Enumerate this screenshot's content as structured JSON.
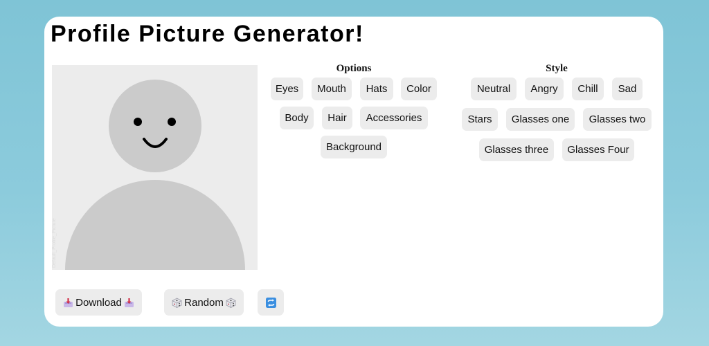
{
  "app": {
    "title": "Profile Picture Generator!"
  },
  "preview": {
    "watermark": "Default_Profile_Picture"
  },
  "options": {
    "heading": "Options",
    "items": [
      "Eyes",
      "Mouth",
      "Hats",
      "Color",
      "Body",
      "Hair",
      "Accessories",
      "Background"
    ]
  },
  "style": {
    "heading": "Style",
    "items": [
      "Neutral",
      "Angry",
      "Chill",
      "Sad",
      "Stars",
      "Glasses one",
      "Glasses two",
      "Glasses three",
      "Glasses Four"
    ]
  },
  "actions": {
    "download_label": "Download",
    "random_label": "Random"
  },
  "icons": {
    "download": "download-tray-icon",
    "random": "dice-icon",
    "refresh": "refresh-icon"
  },
  "colors": {
    "background": "#8ccbdc",
    "card": "#ffffff",
    "chip": "#ececec",
    "avatar": "#cbcbcb",
    "refresh_icon": "#3b8fe0"
  }
}
